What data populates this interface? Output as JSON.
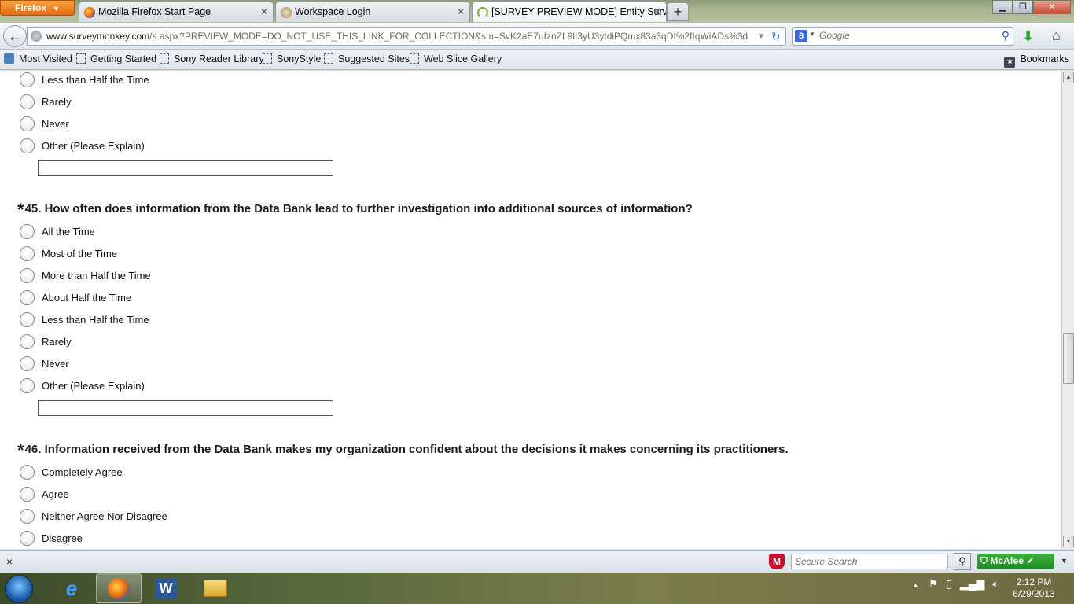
{
  "browser": {
    "menu_button": "Firefox",
    "tabs": [
      {
        "title": "Mozilla Firefox Start Page",
        "active": false
      },
      {
        "title": "Workspace Login",
        "active": false
      },
      {
        "title": "[SURVEY PREVIEW MODE] Entity Surv...",
        "active": true
      }
    ],
    "url_domain": "www.surveymonkey.com",
    "url_path": "/s.aspx?PREVIEW_MODE=DO_NOT_USE_THIS_LINK_FOR_COLLECTION&sm=SvK2aE7uIznZL9lI3yU3ytdiPQmx83a3qDI%2fIqWiADs%3d",
    "search_placeholder": "Google",
    "search_engine_letter": "8",
    "bookmarks": [
      {
        "label": "Most Visited"
      },
      {
        "label": "Getting Started"
      },
      {
        "label": "Sony Reader Library"
      },
      {
        "label": "SonyStyle"
      },
      {
        "label": "Suggested Sites"
      },
      {
        "label": "Web Slice Gallery"
      }
    ],
    "bookmarks_menu": "Bookmarks"
  },
  "survey": {
    "prev_question_options": [
      "Less than Half the Time",
      "Rarely",
      "Never",
      "Other (Please Explain)"
    ],
    "q45": {
      "required_mark": "*",
      "text": "45. How often does information from the Data Bank lead to further investigation into additional sources of information?",
      "options": [
        "All the Time",
        "Most of the Time",
        "More than Half the Time",
        "About Half the Time",
        "Less than Half the Time",
        "Rarely",
        "Never",
        "Other (Please Explain)"
      ]
    },
    "q46": {
      "required_mark": "*",
      "text": "46. Information received from the Data Bank makes my organization confident about the decisions it makes concerning its practitioners.",
      "options": [
        "Completely Agree",
        "Agree",
        "Neither Agree Nor Disagree",
        "Disagree"
      ]
    }
  },
  "addon_bar": {
    "close": "×",
    "secure_search_placeholder": "Secure Search",
    "mcafee_label": "McAfee"
  },
  "taskbar": {
    "word_label": "W",
    "time": "2:12 PM",
    "date": "6/29/2013"
  },
  "colors": {
    "firefox_orange": "#e46a10",
    "mcafee_green": "#2a9a2c",
    "mcafee_red": "#c8102e"
  }
}
